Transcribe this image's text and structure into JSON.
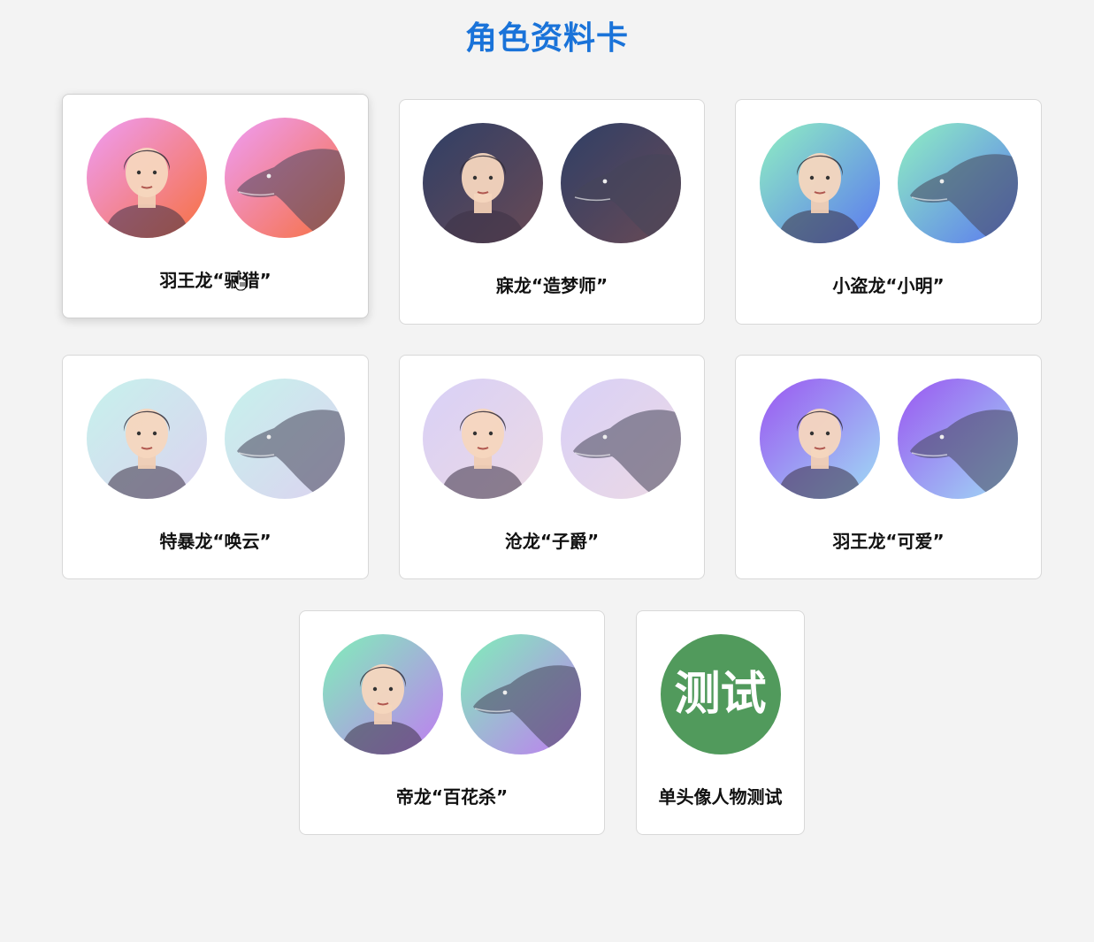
{
  "page": {
    "title": "角色资料卡"
  },
  "cards": [
    {
      "name": "羽王龙“骊猎”",
      "avatars": [
        "human-portrait-icon",
        "dinosaur-portrait-icon"
      ],
      "colors": [
        [
          "#ee9df7",
          "#f7703f"
        ],
        [
          "#ee9df7",
          "#f7703f"
        ]
      ]
    },
    {
      "name": "寐龙“造梦师”",
      "avatars": [
        "human-portrait-icon",
        "dinosaur-portrait-icon"
      ],
      "colors": [
        [
          "#2f3f66",
          "#6a4a55"
        ],
        [
          "#2f3f66",
          "#6a4a55"
        ]
      ]
    },
    {
      "name": "小盗龙“小明”",
      "avatars": [
        "human-portrait-icon",
        "dinosaur-portrait-icon"
      ],
      "colors": [
        [
          "#8ff0c2",
          "#5b78f0"
        ],
        [
          "#8ff0c2",
          "#5b78f0"
        ]
      ]
    },
    {
      "name": "特暴龙“唤云”",
      "avatars": [
        "human-portrait-icon",
        "dinosaur-portrait-icon"
      ],
      "colors": [
        [
          "#c6f2ec",
          "#dcd2f0"
        ],
        [
          "#c6f2ec",
          "#dcd2f0"
        ]
      ]
    },
    {
      "name": "沧龙“子爵”",
      "avatars": [
        "human-portrait-icon",
        "dinosaur-portrait-icon"
      ],
      "colors": [
        [
          "#d8d0f7",
          "#ecd9e4"
        ],
        [
          "#d8d0f7",
          "#ecd9e4"
        ]
      ]
    },
    {
      "name": "羽王龙“可爱”",
      "avatars": [
        "human-portrait-icon",
        "dinosaur-portrait-icon"
      ],
      "colors": [
        [
          "#9a56f2",
          "#9fdcf4"
        ],
        [
          "#9a56f2",
          "#9fdcf4"
        ]
      ]
    },
    {
      "name": "帝龙“百花杀”",
      "avatars": [
        "human-portrait-icon",
        "dinosaur-portrait-icon"
      ],
      "colors": [
        [
          "#7ff0b8",
          "#c07cf2"
        ],
        [
          "#7ff0b8",
          "#c07cf2"
        ]
      ]
    },
    {
      "name": "单头像人物测试",
      "avatars": [
        "test-badge-icon"
      ],
      "badge_text": "测试",
      "colors": [
        [
          "#519a5c",
          "#519a5c"
        ]
      ]
    }
  ]
}
